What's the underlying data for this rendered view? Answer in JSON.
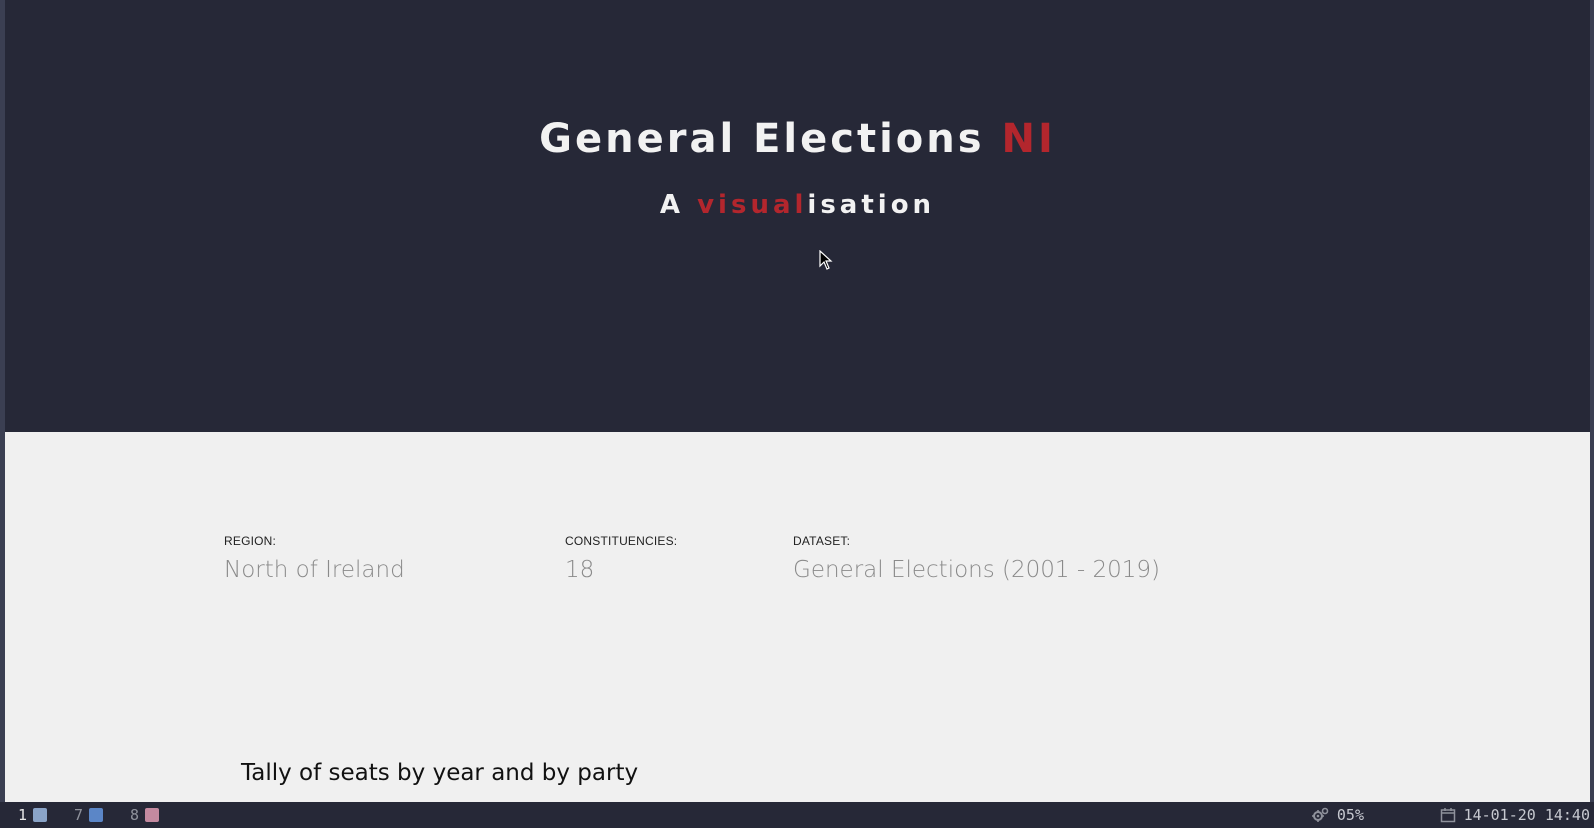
{
  "page": {
    "title_main": "General Elections ",
    "title_accent": "NI",
    "subtitle_prefix": "A ",
    "subtitle_accent": "visual",
    "subtitle_suffix": "isation"
  },
  "stats": [
    {
      "label": "REGION:",
      "value": "North of Ireland"
    },
    {
      "label": "CONSTITUENCIES:",
      "value": "18"
    },
    {
      "label": "DATASET:",
      "value": "General Elections (2001 - 2019)"
    }
  ],
  "section": {
    "heading": "Tally of seats by year and by party"
  },
  "taskbar": {
    "workspaces": [
      {
        "num": "1",
        "color": "#8aa4c8",
        "active": true
      },
      {
        "num": "7",
        "color": "#5b86c7",
        "active": false
      },
      {
        "num": "8",
        "color": "#c48aa0",
        "active": false
      }
    ],
    "cpu_text": "05%",
    "datetime_text": "14-01-20 14:40"
  },
  "colors": {
    "hero_background": "#262837",
    "accent": "#b3262d",
    "content_background": "#f0f0f0"
  }
}
